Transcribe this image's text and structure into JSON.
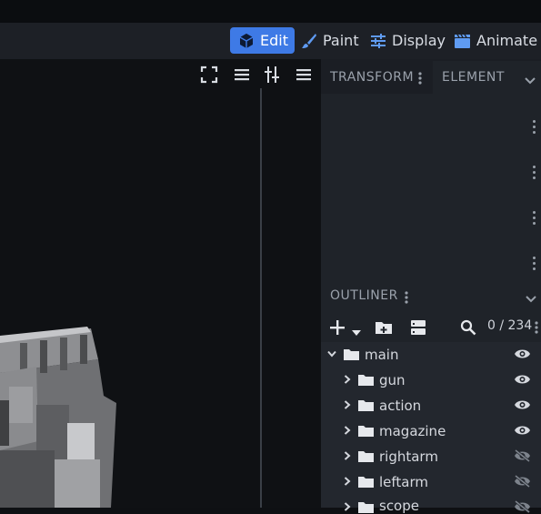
{
  "modes": [
    {
      "label": "Edit",
      "icon": "cube-icon",
      "active": true
    },
    {
      "label": "Paint",
      "icon": "brush-icon",
      "active": false
    },
    {
      "label": "Display",
      "icon": "sliders-icon",
      "active": false
    },
    {
      "label": "Animate",
      "icon": "clapper-icon",
      "active": false
    }
  ],
  "panel": {
    "tabs": [
      "TRANSFORM",
      "ELEMENT"
    ],
    "outliner_title": "OUTLINER",
    "search_count": "0 / 234"
  },
  "tree": [
    {
      "label": "main",
      "expanded": true,
      "visible": true
    },
    {
      "label": "gun",
      "expanded": false,
      "visible": true
    },
    {
      "label": "action",
      "expanded": false,
      "visible": true
    },
    {
      "label": "magazine",
      "expanded": false,
      "visible": true
    },
    {
      "label": "rightarm",
      "expanded": false,
      "visible": false
    },
    {
      "label": "leftarm",
      "expanded": false,
      "visible": false
    },
    {
      "label": "scope",
      "expanded": false,
      "visible": false
    }
  ],
  "colors": {
    "accent": "#3e7ae6",
    "panel": "#1f2329",
    "viewport": "#0f1114"
  }
}
